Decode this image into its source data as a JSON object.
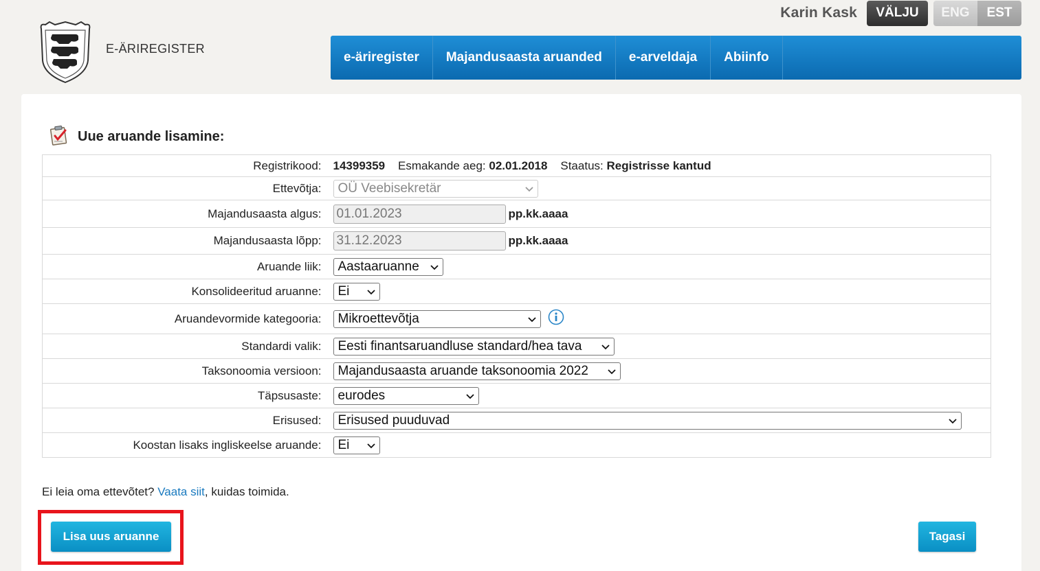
{
  "user": {
    "name": "Karin Kask",
    "logout": "VÄLJU"
  },
  "languages": [
    "ENG",
    "EST"
  ],
  "logo": {
    "text": "E-ÄRIREGISTER",
    "icon": "coat-of-arms-icon"
  },
  "nav": [
    "e-äriregister",
    "Majandusaasta aruanded",
    "e-arveldaja",
    "Abiinfo"
  ],
  "page": {
    "title": "Uue aruande lisamine:"
  },
  "info_row": {
    "regcode_label": "Registrikood:",
    "regcode": "14399359",
    "firstentry_label": "Esmakande aeg:",
    "firstentry": "02.01.2018",
    "status_label": "Staatus:",
    "status": "Registrisse kantud"
  },
  "fields": {
    "company": {
      "label": "Ettevõtja:",
      "value": "OÜ Veebisekretär"
    },
    "start": {
      "label": "Majandusaasta algus:",
      "value": "01.01.2023",
      "format": "pp.kk.aaaa"
    },
    "end": {
      "label": "Majandusaasta lõpp:",
      "value": "31.12.2023",
      "format": "pp.kk.aaaa"
    },
    "type": {
      "label": "Aruande liik:",
      "value": "Aastaaruanne"
    },
    "consolidated": {
      "label": "Konsolideeritud aruanne:",
      "value": "Ei"
    },
    "category": {
      "label": "Aruandevormide kategooria:",
      "value": "Mikroettevõtja"
    },
    "standard": {
      "label": "Standardi valik:",
      "value": "Eesti finantsaruandluse standard/hea tava"
    },
    "taxonomy": {
      "label": "Taksonoomia versioon:",
      "value": "Majandusaasta aruande taksonoomia 2022"
    },
    "precision": {
      "label": "Täpsusaste:",
      "value": "eurodes"
    },
    "exceptions": {
      "label": "Erisused:",
      "value": "Erisused puuduvad"
    },
    "english": {
      "label": "Koostan lisaks ingliskeelse aruande:",
      "value": "Ei"
    }
  },
  "hint": {
    "before": "Ei leia oma ettevõtet? ",
    "link": "Vaata siit",
    "after": ", kuidas toimida."
  },
  "buttons": {
    "add": "Lisa uus aruanne",
    "back": "Tagasi"
  },
  "colors": {
    "nav": "#0b6ab0",
    "button": "#0a8fc4",
    "highlight": "#e8141c"
  }
}
